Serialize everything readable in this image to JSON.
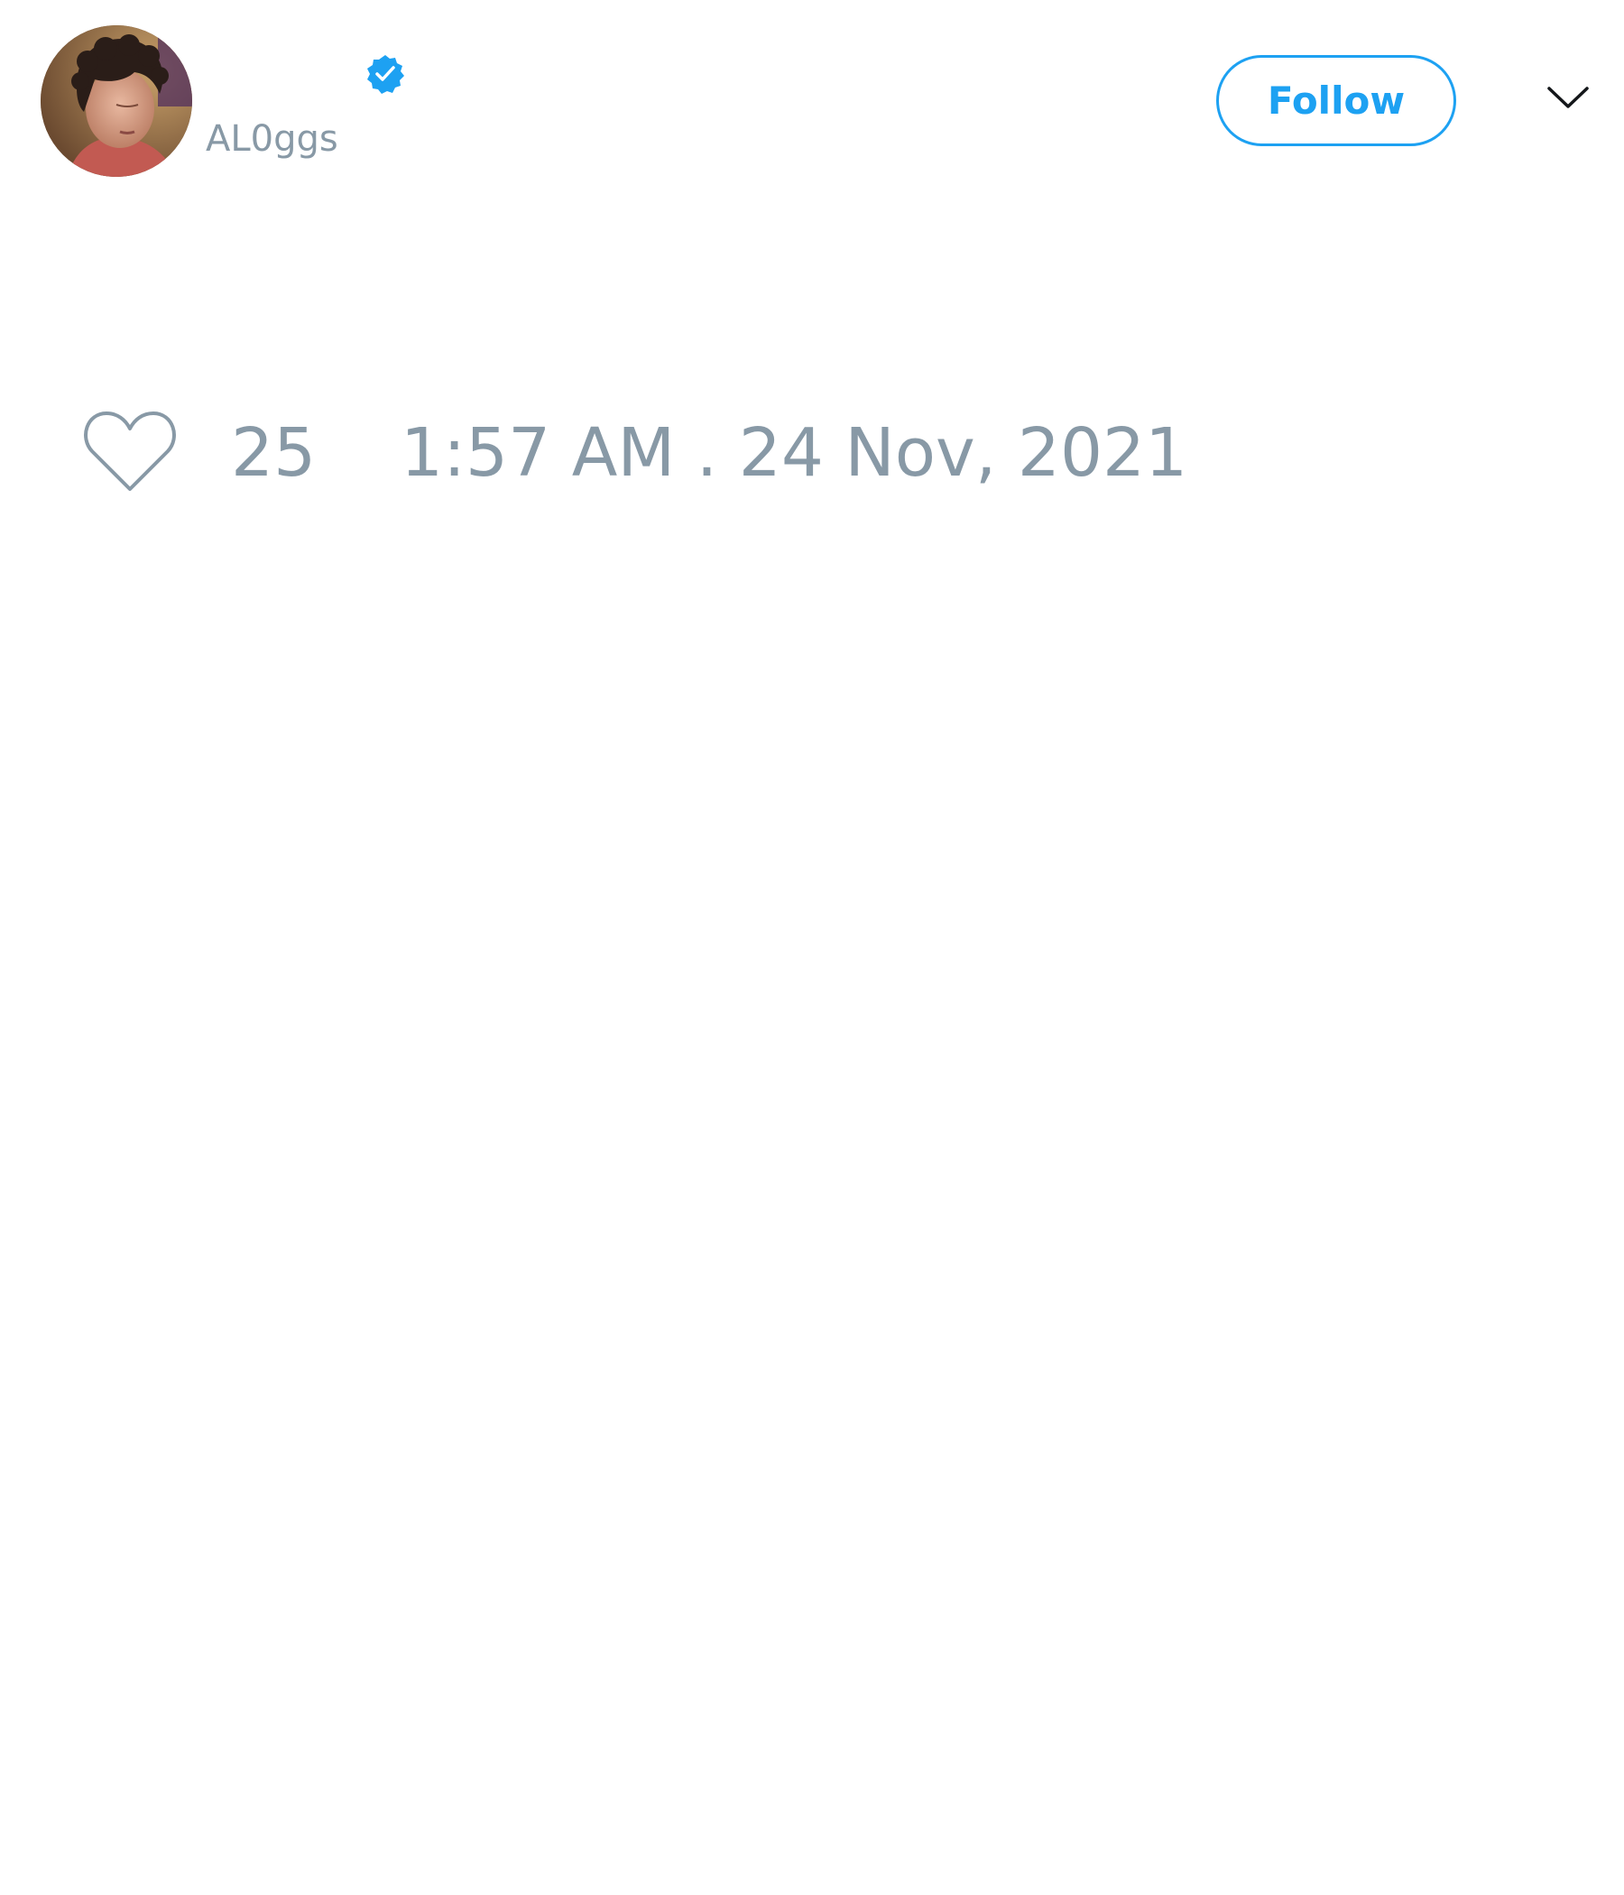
{
  "tweet": {
    "author": {
      "display_name": "",
      "handle": "AL0ggs",
      "verified": true,
      "avatar_icon": "profile-photo"
    },
    "actions": {
      "follow_label": "Follow",
      "menu_icon": "chevron-down-icon"
    },
    "text": "",
    "footer": {
      "like_icon": "heart-outline-icon",
      "like_count": "25",
      "timestamp": "1:57 AM . 24 Nov, 2021"
    }
  },
  "colors": {
    "accent": "#1da1f2",
    "muted_text": "#8899a6",
    "background": "#ffffff"
  }
}
